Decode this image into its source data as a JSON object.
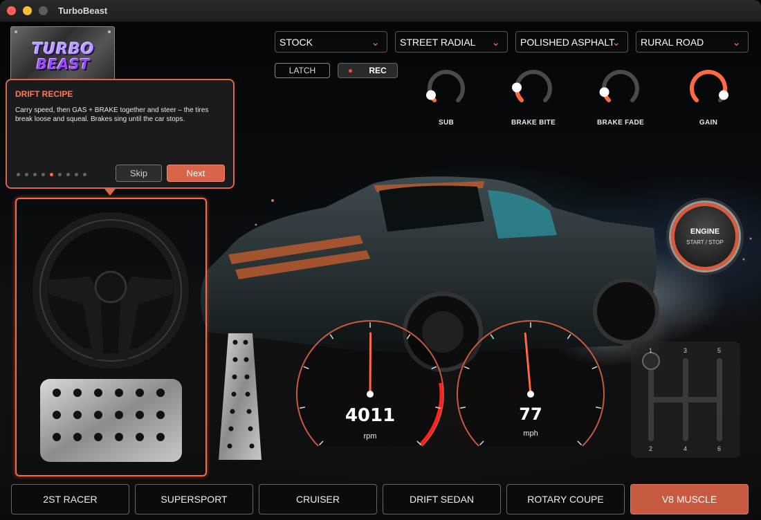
{
  "window": {
    "title": "TurboBeast"
  },
  "logo": {
    "line1": "TURBO",
    "line2": "BEAST"
  },
  "dropdowns": [
    {
      "label": "STOCK"
    },
    {
      "label": "STREET RADIAL"
    },
    {
      "label": "POLISHED ASPHALT"
    },
    {
      "label": "RURAL ROAD"
    }
  ],
  "controls": {
    "latch_label": "LATCH",
    "rec_label": "REC"
  },
  "knobs": [
    {
      "label": "SUB",
      "value": 0.08
    },
    {
      "label": "BRAKE BITE",
      "value": 0.18
    },
    {
      "label": "BRAKE FADE",
      "value": 0.12
    },
    {
      "label": "GAIN",
      "value": 0.92
    }
  ],
  "tutorial": {
    "title": "DRIFT RECIPE",
    "body": "Carry speed, then GAS + BRAKE together and steer – the tires break loose and squeal. Brakes sing until the car stops.",
    "step": 5,
    "total_steps": 9,
    "skip_label": "Skip",
    "next_label": "Next"
  },
  "gauges": {
    "rpm": {
      "value": "4011",
      "unit": "rpm"
    },
    "speed": {
      "value": "77",
      "unit": "mph"
    }
  },
  "engine_button": {
    "line1": "ENGINE",
    "line2": "START / STOP"
  },
  "shifter": {
    "gears": [
      "1",
      "3",
      "5",
      "2",
      "4",
      "6"
    ]
  },
  "car_tabs": [
    {
      "label": "2ST RACER",
      "active": false
    },
    {
      "label": "SUPERSPORT",
      "active": false
    },
    {
      "label": "CRUISER",
      "active": false
    },
    {
      "label": "DRIFT SEDAN",
      "active": false
    },
    {
      "label": "ROTARY COUPE",
      "active": false
    },
    {
      "label": "V8 MUSCLE",
      "active": true
    }
  ],
  "colors": {
    "accent": "#ff6a45",
    "active_tab": "#c95a42",
    "popup_border": "#e0664a"
  }
}
